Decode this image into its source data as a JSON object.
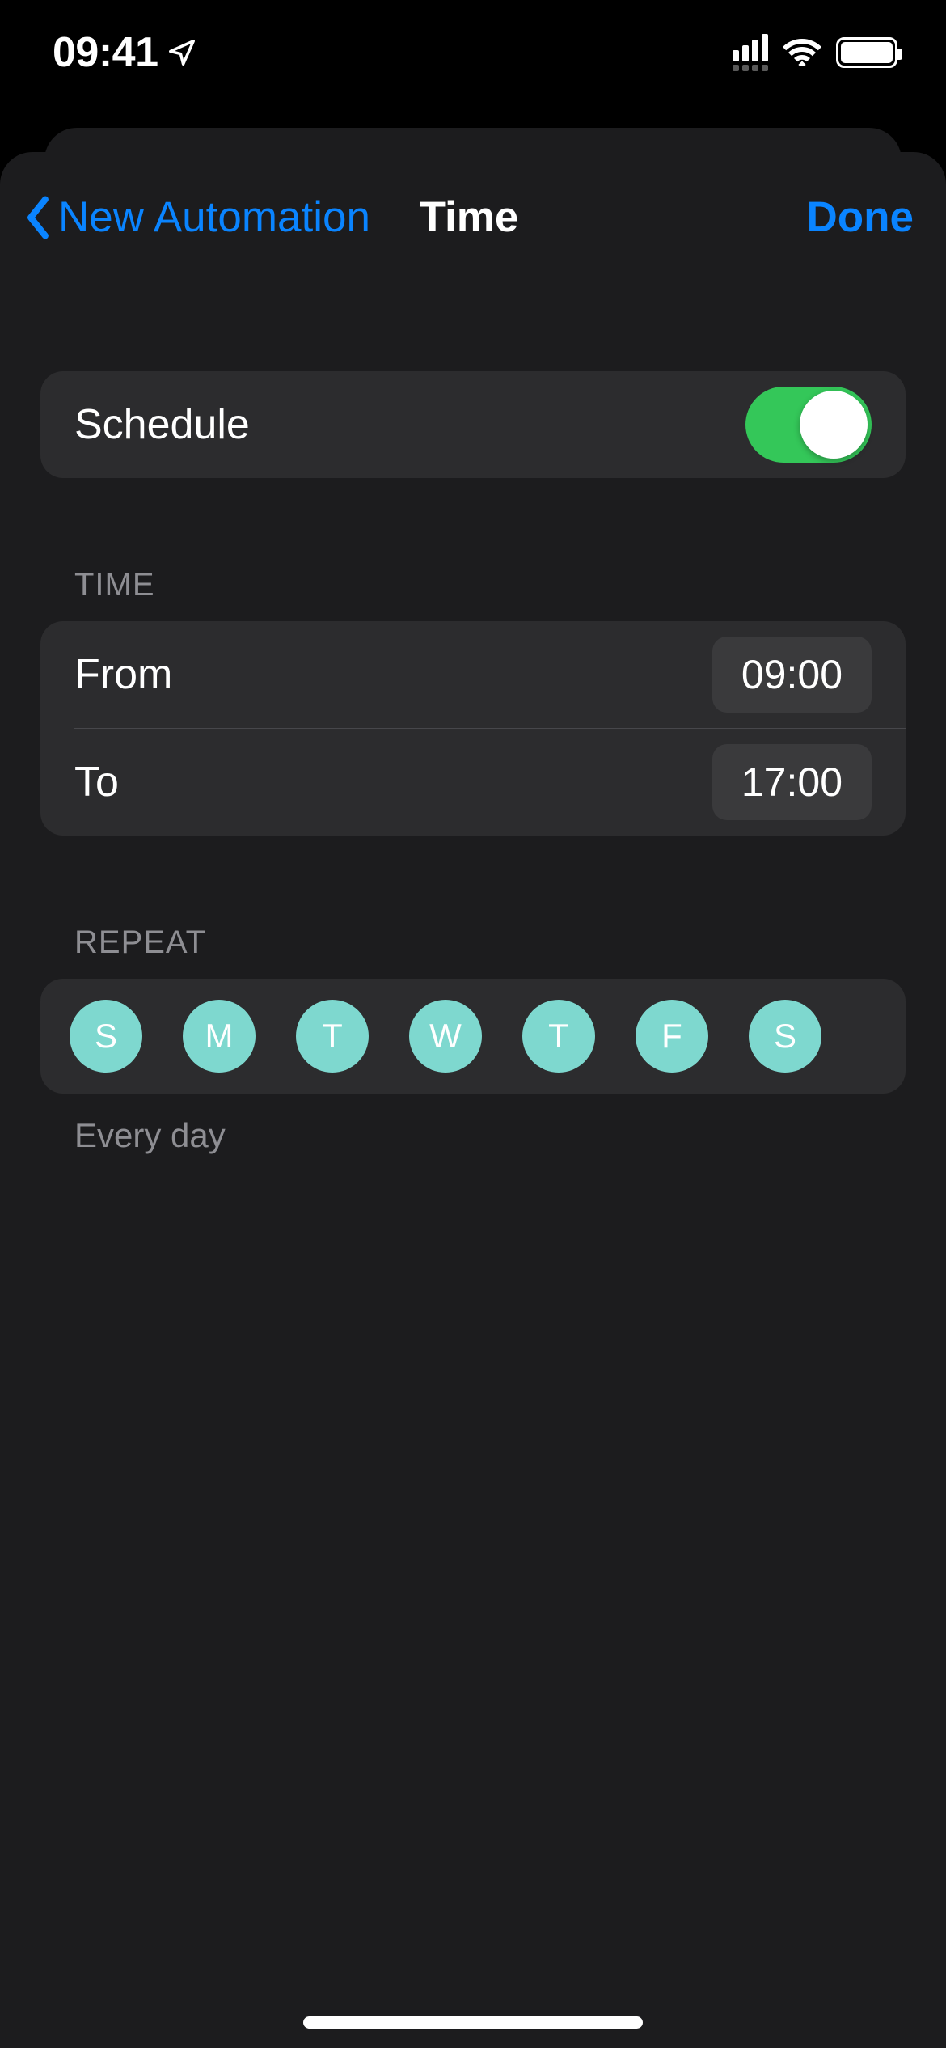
{
  "statusBar": {
    "time": "09:41"
  },
  "nav": {
    "back": "New Automation",
    "title": "Time",
    "done": "Done"
  },
  "schedule": {
    "label": "Schedule",
    "enabled": true
  },
  "time": {
    "header": "TIME",
    "fromLabel": "From",
    "fromValue": "09:00",
    "toLabel": "To",
    "toValue": "17:00"
  },
  "repeat": {
    "header": "REPEAT",
    "days": [
      "S",
      "M",
      "T",
      "W",
      "T",
      "F",
      "S"
    ],
    "footer": "Every day"
  }
}
